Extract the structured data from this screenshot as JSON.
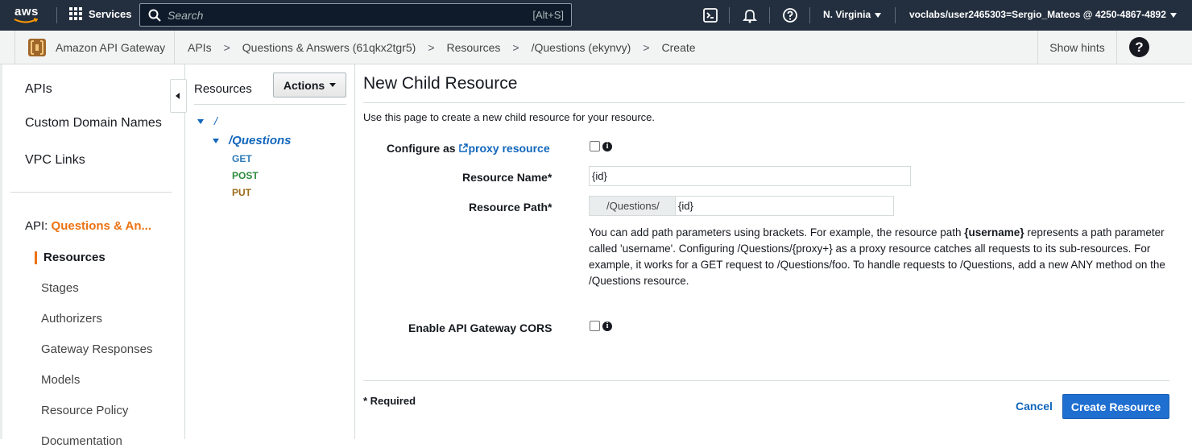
{
  "topbar": {
    "logo_text": "aws",
    "services_label": "Services",
    "search_placeholder": "Search",
    "search_shortcut": "[Alt+S]",
    "region": "N. Virginia",
    "account": "voclabs/user2465303=Sergio_Mateos @ 4250-4867-4892",
    "icons": [
      "cloudshell-icon",
      "bell-icon",
      "help-icon"
    ]
  },
  "service_bar": {
    "service_name": "Amazon API Gateway",
    "breadcrumbs": [
      "APIs",
      "Questions & Answers (61qkx2tgr5)",
      "Resources",
      "/Questions (ekynvy)",
      "Create"
    ],
    "separator": ">",
    "show_hints": "Show hints"
  },
  "left_nav": {
    "items": [
      "APIs",
      "Custom Domain Names",
      "VPC Links"
    ],
    "api_prefix": "API:",
    "api_name": "Questions & An...",
    "sub_items": [
      "Resources",
      "Stages",
      "Authorizers",
      "Gateway Responses",
      "Models",
      "Resource Policy",
      "Documentation"
    ],
    "active": "Resources"
  },
  "resources_panel": {
    "title": "Resources",
    "actions_label": "Actions",
    "root": "/",
    "child": "/Questions",
    "methods": [
      "GET",
      "POST",
      "PUT"
    ]
  },
  "form": {
    "heading": "New Child Resource",
    "description": "Use this page to create a new child resource for your resource.",
    "proxy_label_prefix": "Configure as",
    "proxy_link": "proxy resource",
    "resource_name_label": "Resource Name*",
    "resource_name_value": "{id}",
    "resource_path_label": "Resource Path*",
    "resource_path_prefix": "/Questions/",
    "resource_path_value": "{id}",
    "help_before": "You can add path parameters using brackets. For example, the resource path ",
    "help_bold": "{username}",
    "help_after": " represents a path parameter called 'username'. Configuring /Questions/{proxy+} as a proxy resource catches all requests to its sub-resources. For example, it works for a GET request to /Questions/foo. To handle requests to /Questions, add a new ANY method on the /Questions resource.",
    "cors_label": "Enable API Gateway CORS",
    "required_note": "* Required",
    "cancel_label": "Cancel",
    "create_label": "Create Resource"
  }
}
